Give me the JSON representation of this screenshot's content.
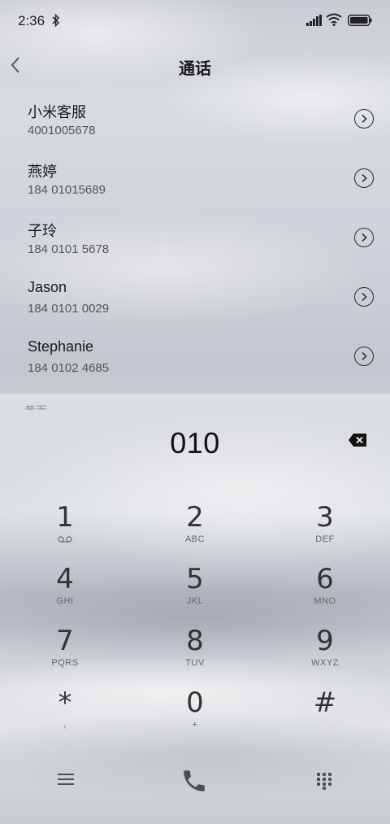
{
  "status_bar": {
    "time": "2:36",
    "icons": [
      "bluetooth-icon",
      "signal-icon",
      "wifi-icon",
      "battery-icon"
    ]
  },
  "header": {
    "title": "通话",
    "back_icon": "chevron-left-icon"
  },
  "contacts": [
    {
      "name": "小米客服",
      "number": "4001005678"
    },
    {
      "name": "燕婷",
      "number": "184 01015689"
    },
    {
      "name": "子玲",
      "number": "184 0101 5678"
    },
    {
      "name": "Jason",
      "number": "184 0101 0029"
    },
    {
      "name": "Stephanie",
      "number": "184 0102 4685"
    }
  ],
  "section_peek": "黄而",
  "dialer": {
    "input_value": "010",
    "backspace_icon": "backspace-icon",
    "keys": [
      {
        "digit": "1",
        "letters": "",
        "sub_icon": "voicemail-icon"
      },
      {
        "digit": "2",
        "letters": "ABC"
      },
      {
        "digit": "3",
        "letters": "DEF"
      },
      {
        "digit": "4",
        "letters": "GHI"
      },
      {
        "digit": "5",
        "letters": "JKL"
      },
      {
        "digit": "6",
        "letters": "MNO"
      },
      {
        "digit": "7",
        "letters": "PQRS"
      },
      {
        "digit": "8",
        "letters": "TUV"
      },
      {
        "digit": "9",
        "letters": "WXYZ"
      },
      {
        "digit": "*",
        "letters": ","
      },
      {
        "digit": "0",
        "letters": "+"
      },
      {
        "digit": "#",
        "letters": ""
      }
    ]
  },
  "bottom_bar": {
    "icons": [
      "menu-icon",
      "phone-icon",
      "dialpad-icon"
    ],
    "accent_color": "#4a4f58"
  }
}
